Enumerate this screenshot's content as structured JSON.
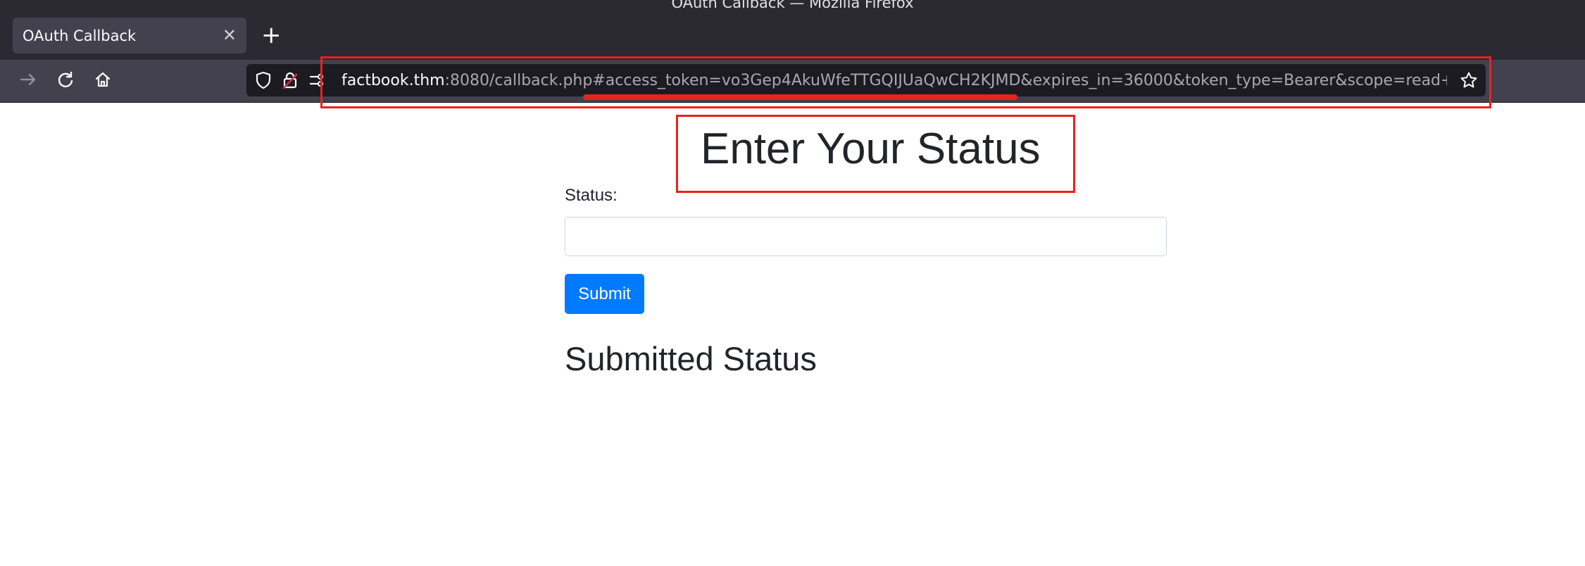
{
  "window": {
    "title": "OAuth Callback — Mozilla Firefox"
  },
  "tabs": [
    {
      "label": "OAuth Callback",
      "active": true
    }
  ],
  "new_tab_label": "+",
  "toolbar": {
    "icons": [
      "forward-arrow-icon",
      "reload-icon",
      "home-icon"
    ]
  },
  "urlbar": {
    "host": "factbook.thm",
    "rest": ":8080/callback.php#access_token=vo3Gep4AkuWfeTTGQIJUaQwCH2KJMD&expires_in=36000&token_type=Bearer&scope=read+write&s",
    "icons": [
      "shield-icon",
      "lock-warning-icon",
      "permissions-icon",
      "star-icon"
    ]
  },
  "page": {
    "heading": "Enter Your Status",
    "status_label": "Status:",
    "status_value": "",
    "submit_label": "Submit",
    "submitted_heading": "Submitted Status"
  },
  "colors": {
    "annotation": "#e8231c",
    "primary_button": "#007bff",
    "chrome_dark": "#2b2a33",
    "toolbar": "#42414d"
  }
}
